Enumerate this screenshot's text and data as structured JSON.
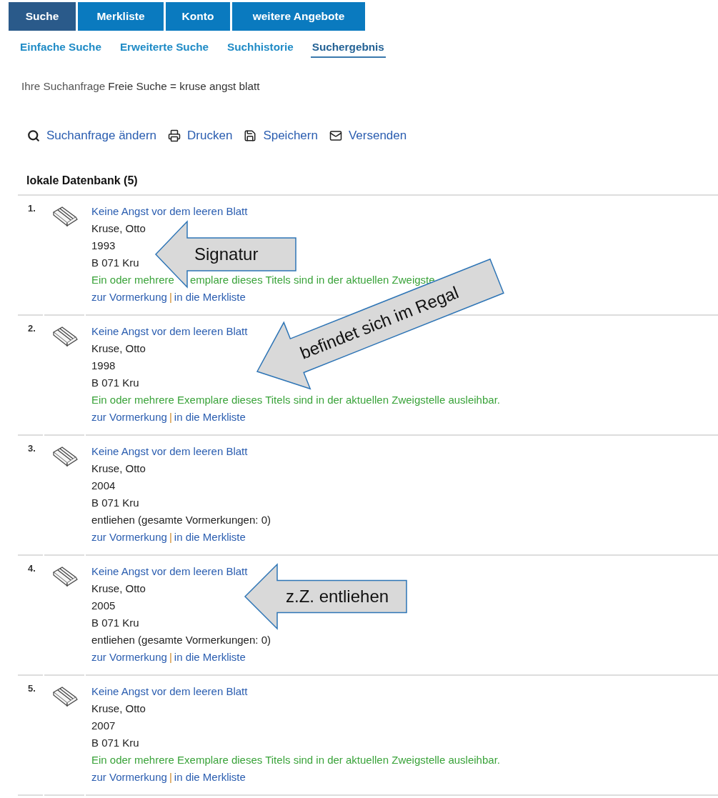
{
  "main_tabs": [
    {
      "label": "Suche",
      "selected": true
    },
    {
      "label": "Merkliste",
      "selected": false
    },
    {
      "label": "Konto",
      "selected": false
    },
    {
      "label": "weitere Angebote",
      "selected": false
    }
  ],
  "sub_tabs": [
    {
      "label": "Einfache Suche",
      "selected": false
    },
    {
      "label": "Erweiterte Suche",
      "selected": false
    },
    {
      "label": "Suchhistorie",
      "selected": false
    },
    {
      "label": "Suchergebnis",
      "selected": true
    }
  ],
  "query": {
    "label": "Ihre Suchanfrage",
    "value": "Freie Suche = kruse angst blatt"
  },
  "actions": [
    {
      "kind": "search",
      "label": "Suchanfrage ändern"
    },
    {
      "kind": "print",
      "label": "Drucken"
    },
    {
      "kind": "save",
      "label": "Speichern"
    },
    {
      "kind": "mail",
      "label": "Versenden"
    }
  ],
  "results_heading": "lokale Datenbank (5)",
  "results": [
    {
      "number": "1.",
      "title": "Keine Angst vor dem leeren Blatt",
      "author": "Kruse, Otto",
      "year": "1993",
      "signature": "B 071 Kru",
      "kind": "available",
      "status": [
        "Ein oder mehrere",
        "emplare dieses Titels sind in der aktuellen Zweigste"
      ],
      "links": [
        "zur Vormerkung",
        "in die Merkliste"
      ],
      "link_separator": "|"
    },
    {
      "number": "2.",
      "title": "Keine Angst vor dem leeren Blatt",
      "author": "Kruse, Otto",
      "year": "1998",
      "signature": "B 071 Kru",
      "kind": "available",
      "status": [
        "Ein oder mehrere Exemplare dieses Titels sind in der aktuellen Zweigstelle ausleihbar."
      ],
      "links": [
        "zur Vormerkung",
        "in die Merkliste"
      ],
      "link_separator": "|"
    },
    {
      "number": "3.",
      "title": "Keine Angst vor dem leeren Blatt",
      "author": "Kruse, Otto",
      "year": "2004",
      "signature": "B 071 Kru",
      "kind": "lent",
      "status": [
        "entliehen (gesamte Vormerkungen: 0)"
      ],
      "links": [
        "zur Vormerkung",
        "in die Merkliste"
      ],
      "link_separator": "|"
    },
    {
      "number": "4.",
      "title": "Keine Angst vor dem leeren Blatt",
      "author": "Kruse, Otto",
      "year": "2005",
      "signature": "B 071 Kru",
      "kind": "lent",
      "status": [
        "entliehen (gesamte Vormerkungen: 0)"
      ],
      "links": [
        "zur Vormerkung",
        "in die Merkliste"
      ],
      "link_separator": "|"
    },
    {
      "number": "5.",
      "title": "Keine Angst vor dem leeren Blatt",
      "author": "Kruse, Otto",
      "year": "2007",
      "signature": "B 071 Kru",
      "kind": "available",
      "status": [
        "Ein oder mehrere Exemplare dieses Titels sind in der aktuellen Zweigstelle ausleihbar."
      ],
      "links": [
        "zur Vormerkung",
        "in die Merkliste"
      ],
      "link_separator": "|"
    }
  ],
  "annotations": [
    {
      "label": "Signatur"
    },
    {
      "label": "befindet sich im Regal"
    },
    {
      "label": "z.Z. entliehen"
    }
  ]
}
